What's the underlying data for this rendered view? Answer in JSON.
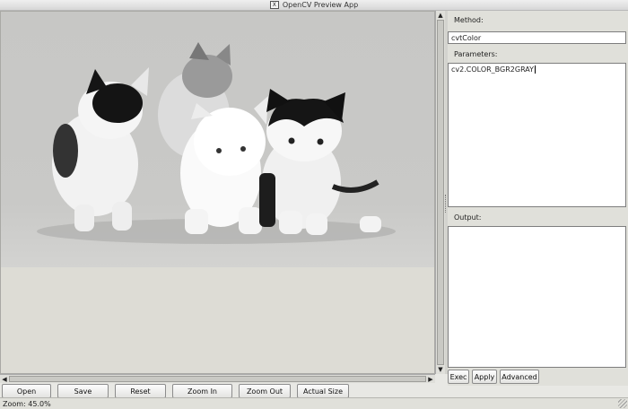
{
  "window": {
    "title": "OpenCV Preview App",
    "icon": "x11-app-icon"
  },
  "image_view": {
    "image": "grayscale-kittens-photo",
    "vscroll": "vertical-scrollbar",
    "hscroll": "horizontal-scrollbar"
  },
  "method": {
    "label": "Method:",
    "value": "cvtColor"
  },
  "parameters": {
    "label": "Parameters:",
    "value": "cv2.COLOR_BGR2GRAY"
  },
  "output": {
    "label": "Output:",
    "value": ""
  },
  "side_buttons": {
    "exec": "Exec",
    "apply": "Apply",
    "advanced": "Advanced"
  },
  "toolbar": {
    "open": "Open",
    "save": "Save",
    "reset": "Reset",
    "zoom_in": "Zoom In",
    "zoom_out": "Zoom Out",
    "actual_size": "Actual Size"
  },
  "status": {
    "text": "Zoom: 45.0%"
  }
}
